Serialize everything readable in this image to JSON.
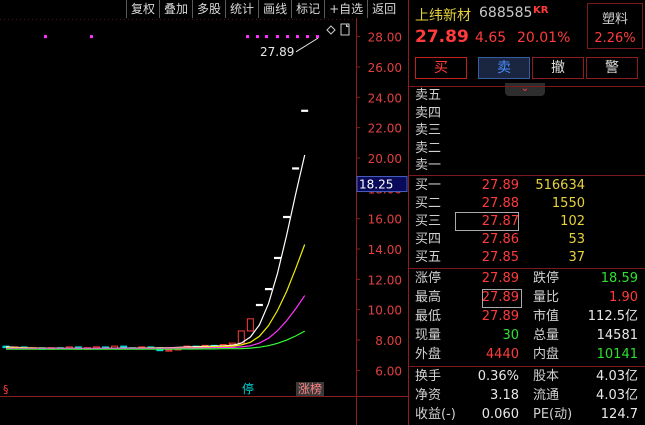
{
  "toolbar": {
    "buttons": [
      "复权",
      "叠加",
      "多股",
      "统计",
      "画线",
      "标记",
      "+自选",
      "返回"
    ]
  },
  "chart_data": {
    "type": "line",
    "y_ticks": [
      "28.00",
      "26.00",
      "24.00",
      "22.00",
      "20.00",
      "18.00",
      "16.00",
      "14.00",
      "12.00",
      "10.00",
      "8.00",
      "6.00"
    ],
    "ylim": [
      5.5,
      29.0
    ],
    "current_price_marker": "18.25",
    "high_annotation": "27.89",
    "bottom_tags": [
      "停",
      "涨榜"
    ],
    "left_tag": "§",
    "colors": {
      "up": "#ff3b3b",
      "down": "#00d8d8",
      "ma5": "#ffffff",
      "ma10": "#f0f000",
      "ma20": "#ff33ff",
      "ma60": "#33ff33"
    },
    "series": [
      {
        "key": "ma5",
        "color": "#ffffff",
        "values": [
          7.55,
          7.52,
          7.5,
          7.48,
          7.47,
          7.45,
          7.45,
          7.44,
          7.43,
          7.43,
          7.44,
          7.45,
          7.46,
          7.47,
          7.47,
          7.48,
          7.48,
          7.49,
          7.5,
          7.52,
          7.54,
          7.56,
          7.58,
          7.6,
          7.62,
          7.65,
          7.8,
          8.2,
          9.0,
          10.4,
          12.4,
          14.9,
          17.6,
          20.2
        ]
      },
      {
        "key": "ma10",
        "color": "#f0f000",
        "values": [
          7.5,
          7.5,
          7.49,
          7.48,
          7.47,
          7.46,
          7.46,
          7.45,
          7.45,
          7.44,
          7.44,
          7.45,
          7.45,
          7.46,
          7.46,
          7.47,
          7.48,
          7.48,
          7.49,
          7.5,
          7.51,
          7.52,
          7.54,
          7.56,
          7.58,
          7.6,
          7.68,
          7.85,
          8.25,
          8.95,
          9.95,
          11.2,
          12.7,
          14.3
        ]
      },
      {
        "key": "ma20",
        "color": "#ff33ff",
        "values": [
          7.45,
          7.45,
          7.45,
          7.45,
          7.45,
          7.45,
          7.45,
          7.45,
          7.45,
          7.45,
          7.45,
          7.45,
          7.45,
          7.45,
          7.45,
          7.46,
          7.46,
          7.46,
          7.47,
          7.47,
          7.48,
          7.48,
          7.49,
          7.5,
          7.51,
          7.52,
          7.55,
          7.62,
          7.8,
          8.12,
          8.62,
          9.27,
          10.05,
          10.93
        ]
      },
      {
        "key": "ma60",
        "color": "#33ff33",
        "values": [
          7.4,
          7.4,
          7.4,
          7.4,
          7.4,
          7.4,
          7.4,
          7.4,
          7.4,
          7.4,
          7.4,
          7.4,
          7.4,
          7.4,
          7.4,
          7.4,
          7.4,
          7.4,
          7.4,
          7.41,
          7.41,
          7.41,
          7.42,
          7.42,
          7.43,
          7.43,
          7.44,
          7.47,
          7.53,
          7.63,
          7.79,
          8.0,
          8.27,
          8.59
        ]
      }
    ],
    "candles": [
      [
        7.6,
        7.5
      ],
      [
        7.5,
        7.55
      ],
      [
        7.55,
        7.45
      ],
      [
        7.45,
        7.5
      ],
      [
        7.5,
        7.4
      ],
      [
        7.4,
        7.5
      ],
      [
        7.5,
        7.45
      ],
      [
        7.45,
        7.55
      ],
      [
        7.55,
        7.4
      ],
      [
        7.4,
        7.5
      ],
      [
        7.5,
        7.55
      ],
      [
        7.55,
        7.45
      ],
      [
        7.45,
        7.6
      ],
      [
        7.6,
        7.5
      ],
      [
        7.5,
        7.45
      ],
      [
        7.45,
        7.55
      ],
      [
        7.55,
        7.5
      ],
      [
        7.5,
        7.3
      ],
      [
        7.3,
        7.35
      ],
      [
        7.35,
        7.5
      ],
      [
        7.5,
        7.6
      ],
      [
        7.6,
        7.55
      ],
      [
        7.55,
        7.65
      ],
      [
        7.65,
        7.6
      ],
      [
        7.6,
        7.7
      ],
      [
        7.7,
        7.8
      ],
      [
        7.8,
        8.6
      ],
      [
        8.6,
        9.4
      ],
      [
        10.3,
        10.35
      ],
      [
        11.4,
        11.4
      ],
      [
        13.4,
        13.45
      ],
      [
        16.1,
        16.15
      ],
      [
        19.3,
        19.35
      ],
      [
        23.1,
        23.15
      ]
    ],
    "top_dots": [
      28.0
    ]
  },
  "quote": {
    "name": "上纬新材",
    "code": "688585",
    "kr": "KR",
    "industry": "塑料",
    "industry_pct": "2.26%",
    "price": "27.89",
    "change": "4.65",
    "change_pct": "20.01%",
    "buttons": {
      "buy": "买",
      "sell": "卖",
      "cancel": "撤",
      "alert": "警"
    },
    "expand_glyph": "⌄",
    "asks": [
      {
        "label": "卖五",
        "price": "",
        "vol": ""
      },
      {
        "label": "卖四",
        "price": "",
        "vol": ""
      },
      {
        "label": "卖三",
        "price": "",
        "vol": ""
      },
      {
        "label": "卖二",
        "price": "",
        "vol": ""
      },
      {
        "label": "卖一",
        "price": "",
        "vol": ""
      }
    ],
    "bids": [
      {
        "label": "买一",
        "price": "27.89",
        "vol": "516634"
      },
      {
        "label": "买二",
        "price": "27.88",
        "vol": "1550"
      },
      {
        "label": "买三",
        "price": "27.87",
        "vol": "102"
      },
      {
        "label": "买四",
        "price": "27.86",
        "vol": "53"
      },
      {
        "label": "买五",
        "price": "27.85",
        "vol": "37"
      }
    ],
    "stats": [
      {
        "l1": "涨停",
        "v1": "27.89",
        "c1": "red",
        "l2": "跌停",
        "v2": "18.59",
        "c2": "green"
      },
      {
        "l1": "最高",
        "v1": "27.89",
        "c1": "red",
        "l2": "量比",
        "v2": "1.90",
        "c2": "red"
      },
      {
        "l1": "最低",
        "v1": "27.89",
        "c1": "red",
        "l2": "市值",
        "v2": "112.5亿",
        "c2": "white"
      },
      {
        "l1": "现量",
        "v1": "30",
        "c1": "green",
        "l2": "总量",
        "v2": "14581",
        "c2": "white"
      },
      {
        "l1": "外盘",
        "v1": "4440",
        "c1": "red",
        "l2": "内盘",
        "v2": "10141",
        "c2": "green"
      }
    ],
    "fundamentals": [
      {
        "l1": "换手",
        "v1": "0.36%",
        "l2": "股本",
        "v2": "4.03亿"
      },
      {
        "l1": "净资",
        "v1": "3.18",
        "l2": "流通",
        "v2": "4.03亿"
      },
      {
        "l1": "收益(-)",
        "v1": "0.060",
        "l2": "PE(动)",
        "v2": "124.7"
      }
    ]
  }
}
